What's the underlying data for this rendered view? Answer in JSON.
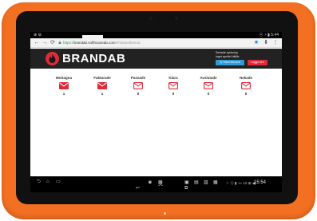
{
  "status_bar": {
    "left_icons": "⊕ ⚙",
    "right_text": "ⓐ ◔ ▮ 5:44"
  },
  "browser": {
    "url_scheme": "https://",
    "url_host": "brandab.softhouseab.com",
    "url_path": "/#/status/bemot"
  },
  "header": {
    "brand_name": "BRANDAB",
    "info_line_1": "Senaste synkning",
    "info_line_2": "Inget synkfel hittills",
    "blue_button": "Ⓞ Sänd inbound",
    "red_button": "Logga ut ▾"
  },
  "columns": [
    {
      "label": "Mottagna",
      "count": "1",
      "icon": "envelope-filled-icon"
    },
    {
      "label": "Fakturade",
      "count": "1",
      "icon": "envelope-filled-icon"
    },
    {
      "label": "Passade",
      "count": "0",
      "icon": "envelope-outline-icon"
    },
    {
      "label": "Klara",
      "count": "0",
      "icon": "envelope-outline-icon"
    },
    {
      "label": "Avslutade",
      "count": "0",
      "icon": "envelope-outline-icon"
    },
    {
      "label": "Nekade",
      "count": "0",
      "icon": "envelope-outline-icon"
    }
  ],
  "nav_bar": {
    "clock": "15:54",
    "system_status": "⚐ ⓐ ▮ ◖◗ 15 ⊞ ◀)"
  },
  "colors": {
    "device_orange": "#f36f21",
    "brand_red": "#e02a3a",
    "header_dark": "#222222",
    "button_blue": "#2e9bd6"
  }
}
